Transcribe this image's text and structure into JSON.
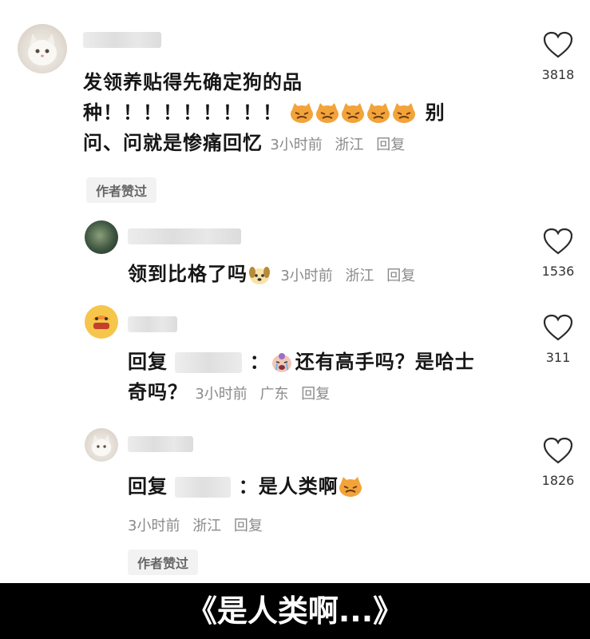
{
  "comments": [
    {
      "text_lines": [
        "发领养贴得先确定狗的品",
        "种！！！！！！！！！",
        "问、问就是惨痛回忆"
      ],
      "trailing_word": "别",
      "time": "3小时前",
      "location": "浙江",
      "reply_label": "回复",
      "badge": "作者赞过",
      "likes": "3818"
    },
    {
      "text": "领到比格了吗",
      "time": "3小时前",
      "location": "浙江",
      "reply_label": "回复",
      "likes": "1536"
    },
    {
      "reply_prefix": "回复",
      "colon": "：",
      "text_line1": "还有高手吗？是哈士",
      "text_line2": "奇吗？",
      "time": "3小时前",
      "location": "广东",
      "reply_label": "回复",
      "likes": "311"
    },
    {
      "reply_prefix": "回复",
      "colon": "：",
      "text": "是人类啊",
      "time": "3小时前",
      "location": "浙江",
      "reply_label": "回复",
      "badge": "作者赞过",
      "likes": "1826"
    }
  ],
  "caption": "《是人类啊...》",
  "colors": {
    "emoji_orange": "#f2a33a",
    "caption_bg": "#000000"
  }
}
